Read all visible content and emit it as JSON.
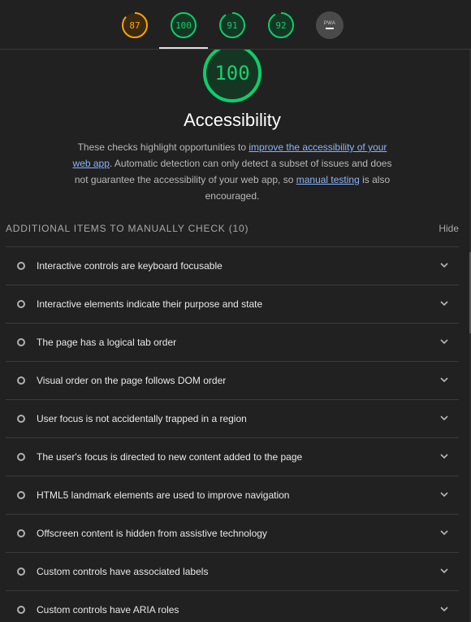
{
  "nav": {
    "gauges": [
      {
        "value": "87",
        "score": 0.87,
        "color": "#ffa400",
        "bg": "#3a2a12"
      },
      {
        "value": "100",
        "score": 1.0,
        "color": "#0cce6b",
        "bg": "#163624"
      },
      {
        "value": "91",
        "score": 0.91,
        "color": "#0cce6b",
        "bg": "#163624"
      },
      {
        "value": "92",
        "score": 0.92,
        "color": "#0cce6b",
        "bg": "#163624"
      }
    ],
    "pwa_label": "PWA"
  },
  "category": {
    "score": "100",
    "title": "Accessibility",
    "desc_1": "These checks highlight opportunities to ",
    "link_1": "improve the accessibility of your web app",
    "desc_2": ". Automatic detection can only detect a subset of issues and does not guarantee the accessibility of your web app, so ",
    "link_2": "manual testing",
    "desc_3": " is also encouraged."
  },
  "manual": {
    "title": "ADDITIONAL ITEMS TO MANUALLY CHECK (10)",
    "hide_label": "Hide",
    "items": [
      "Interactive controls are keyboard focusable",
      "Interactive elements indicate their purpose and state",
      "The page has a logical tab order",
      "Visual order on the page follows DOM order",
      "User focus is not accidentally trapped in a region",
      "The user's focus is directed to new content added to the page",
      "HTML5 landmark elements are used to improve navigation",
      "Offscreen content is hidden from assistive technology",
      "Custom controls have associated labels",
      "Custom controls have ARIA roles"
    ]
  },
  "colors": {
    "pass": "#0cce6b",
    "average": "#ffa400",
    "link": "#8ab4f8"
  }
}
